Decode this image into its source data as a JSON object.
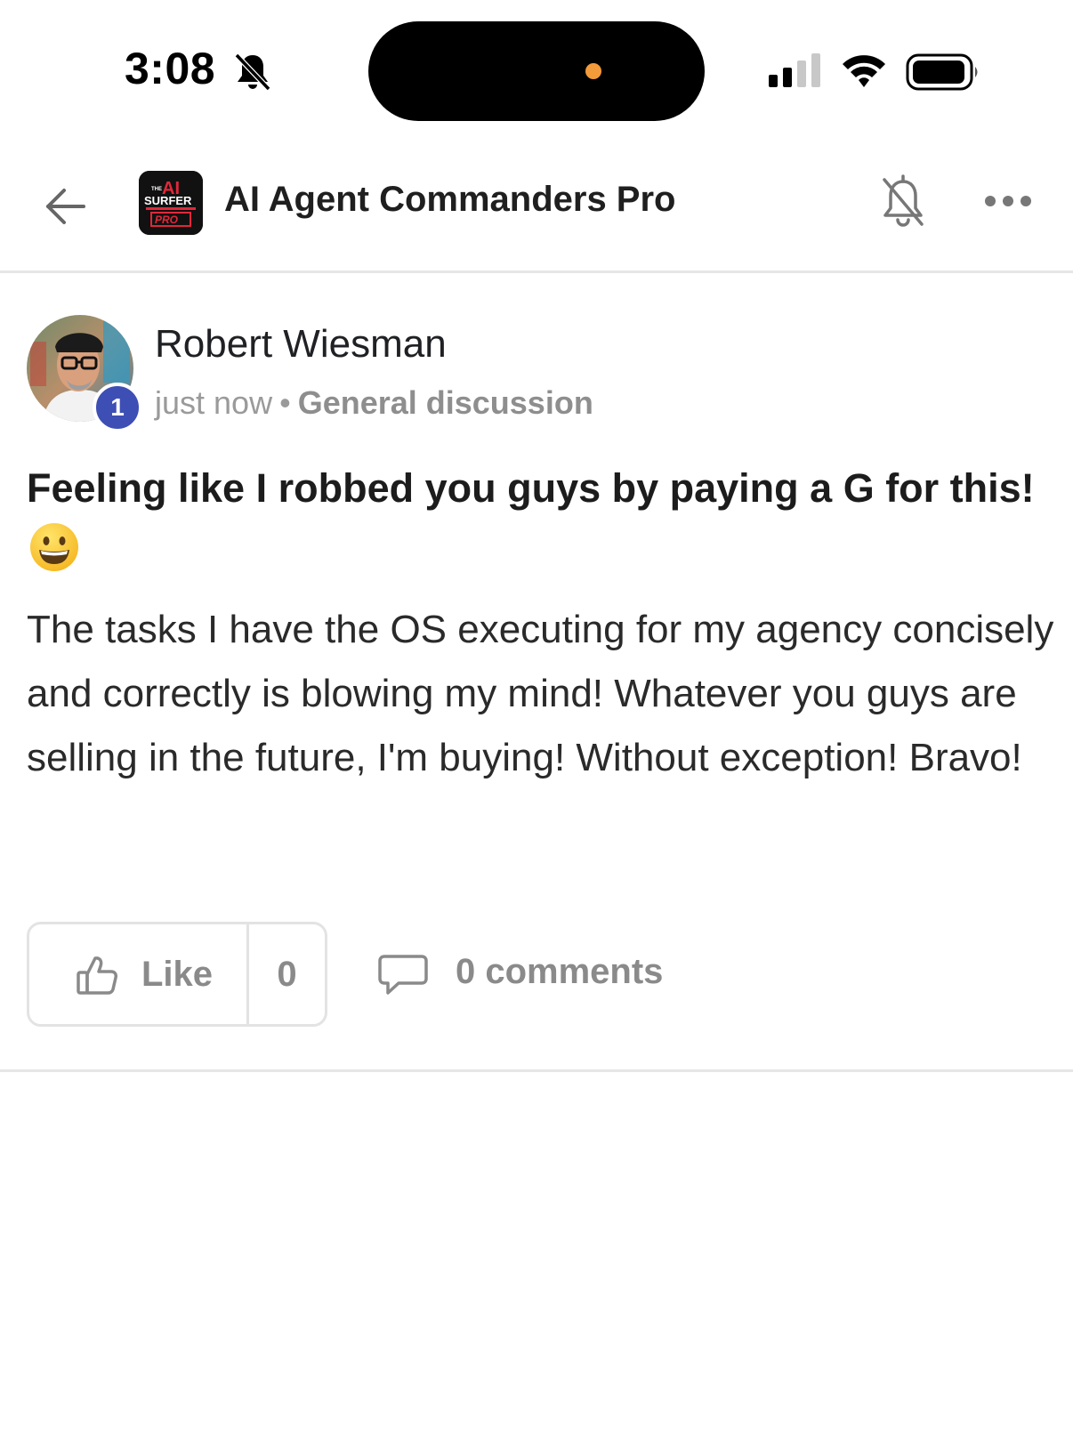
{
  "status_bar": {
    "time": "3:08",
    "icons": [
      "bell-slash-icon",
      "cellular-signal-icon",
      "wifi-icon",
      "battery-icon"
    ]
  },
  "header": {
    "back_icon": "arrow-left-icon",
    "logo": {
      "line1": "THE",
      "line2": "AI",
      "line3": "SURFER",
      "line4": "PRO"
    },
    "title": "AI Agent Commanders Pro",
    "notification_icon": "bell-slash-icon",
    "more_icon": "ellipsis-icon"
  },
  "post": {
    "author": "Robert Wiesman",
    "level": "1",
    "time": "just now",
    "separator": "•",
    "category": "General discussion",
    "title": "Feeling like I robbed you guys by paying a G for this!",
    "title_emoji": "grinning-face-emoji",
    "body": "The tasks I have the OS executing for my agency concisely and correctly is blowing my mind! Whatever you guys are selling in the future, I'm buying! Without exception! Bravo!",
    "actions": {
      "like_label": "Like",
      "like_count": "0",
      "comments_label": "0 comments"
    }
  },
  "colors": {
    "level_badge": "#3d4fb5",
    "muted_text": "#8a8a8a",
    "divider": "#e6e6e6",
    "logo_red": "#e0283a"
  }
}
